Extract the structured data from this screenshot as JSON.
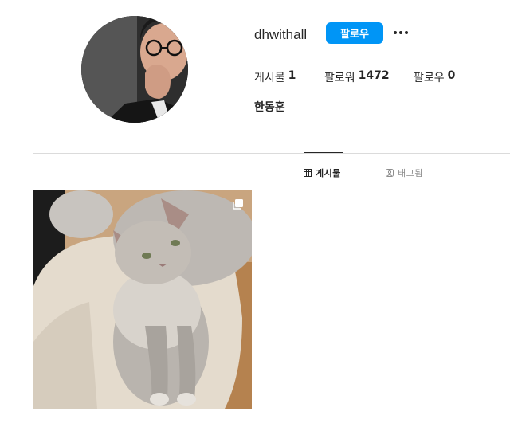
{
  "profile": {
    "username": "dhwithall",
    "full_name": "한동훈",
    "follow_label": "팔로우",
    "more_icon": "more-horizontal-icon"
  },
  "stats": {
    "posts_label": "게시물",
    "posts_count": "1",
    "followers_label": "팔로워",
    "followers_count": "1472",
    "following_label": "팔로우",
    "following_count": "0"
  },
  "tabs": [
    {
      "label": "게시물",
      "icon": "grid-icon",
      "active": true
    },
    {
      "label": "태그됨",
      "icon": "tagged-icon",
      "active": false
    }
  ],
  "posts": [
    {
      "type": "carousel",
      "icon": "carousel-icon"
    }
  ],
  "colors": {
    "accent": "#0095f6",
    "text": "#262626",
    "muted": "#8e8e8e",
    "divider": "#dbdbdb"
  }
}
